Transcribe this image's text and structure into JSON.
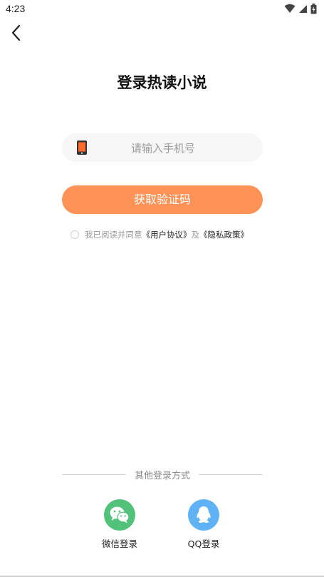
{
  "status": {
    "time": "4:23"
  },
  "header": {
    "title": "登录热读小说"
  },
  "phone": {
    "placeholder": "请输入手机号",
    "value": ""
  },
  "actions": {
    "get_code_label": "获取验证码"
  },
  "agreement": {
    "prefix": "我已阅读并同意",
    "user_agreement": "《用户协议》",
    "conj": "及",
    "privacy_policy": "《隐私政策》",
    "checked": false
  },
  "other_login": {
    "divider_text": "其他登录方式",
    "options": [
      {
        "label": "微信登录",
        "icon": "wechat-icon",
        "color": "#52c27a"
      },
      {
        "label": "QQ登录",
        "icon": "qq-icon",
        "color": "#5fb2f5"
      }
    ]
  },
  "colors": {
    "accent": "#ff9257"
  }
}
